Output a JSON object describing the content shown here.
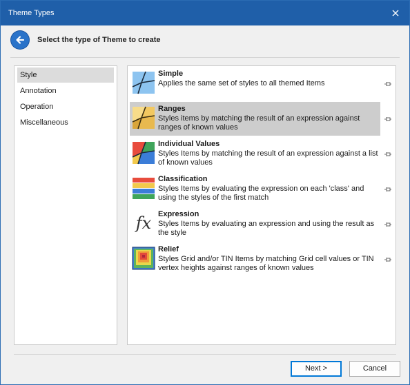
{
  "window": {
    "title": "Theme Types"
  },
  "header": {
    "prompt": "Select the type of Theme to create"
  },
  "categories": [
    {
      "label": "Style",
      "selected": true
    },
    {
      "label": "Annotation"
    },
    {
      "label": "Operation"
    },
    {
      "label": "Miscellaneous"
    }
  ],
  "themes": [
    {
      "name": "Simple",
      "description": "Applies the same set of styles to all themed Items",
      "icon": "simple-theme-icon"
    },
    {
      "name": "Ranges",
      "description": "Styles items by matching the result of an expression against ranges of known values",
      "icon": "ranges-theme-icon",
      "selected": true
    },
    {
      "name": "Individual Values",
      "description": "Styles Items by matching the result of an expression against a list of known values",
      "icon": "individual-values-theme-icon"
    },
    {
      "name": "Classification",
      "description": "Styles Items by evaluating the expression on each 'class' and using the styles of the first match",
      "icon": "classification-theme-icon"
    },
    {
      "name": "Expression",
      "description": "Styles Items by evaluating an expression and using the result as the style",
      "icon": "expression-theme-icon",
      "icon_text": "fx"
    },
    {
      "name": "Relief",
      "description": "Styles Grid and/or TIN Items by matching Grid cell values or TIN vertex heights against ranges of known values",
      "icon": "relief-theme-icon"
    }
  ],
  "buttons": {
    "next": "Next >",
    "cancel": "Cancel"
  },
  "colors": {
    "titlebar": "#1f5fa9",
    "selection": "#cdcdcd",
    "back_button": "#2a73c9"
  }
}
